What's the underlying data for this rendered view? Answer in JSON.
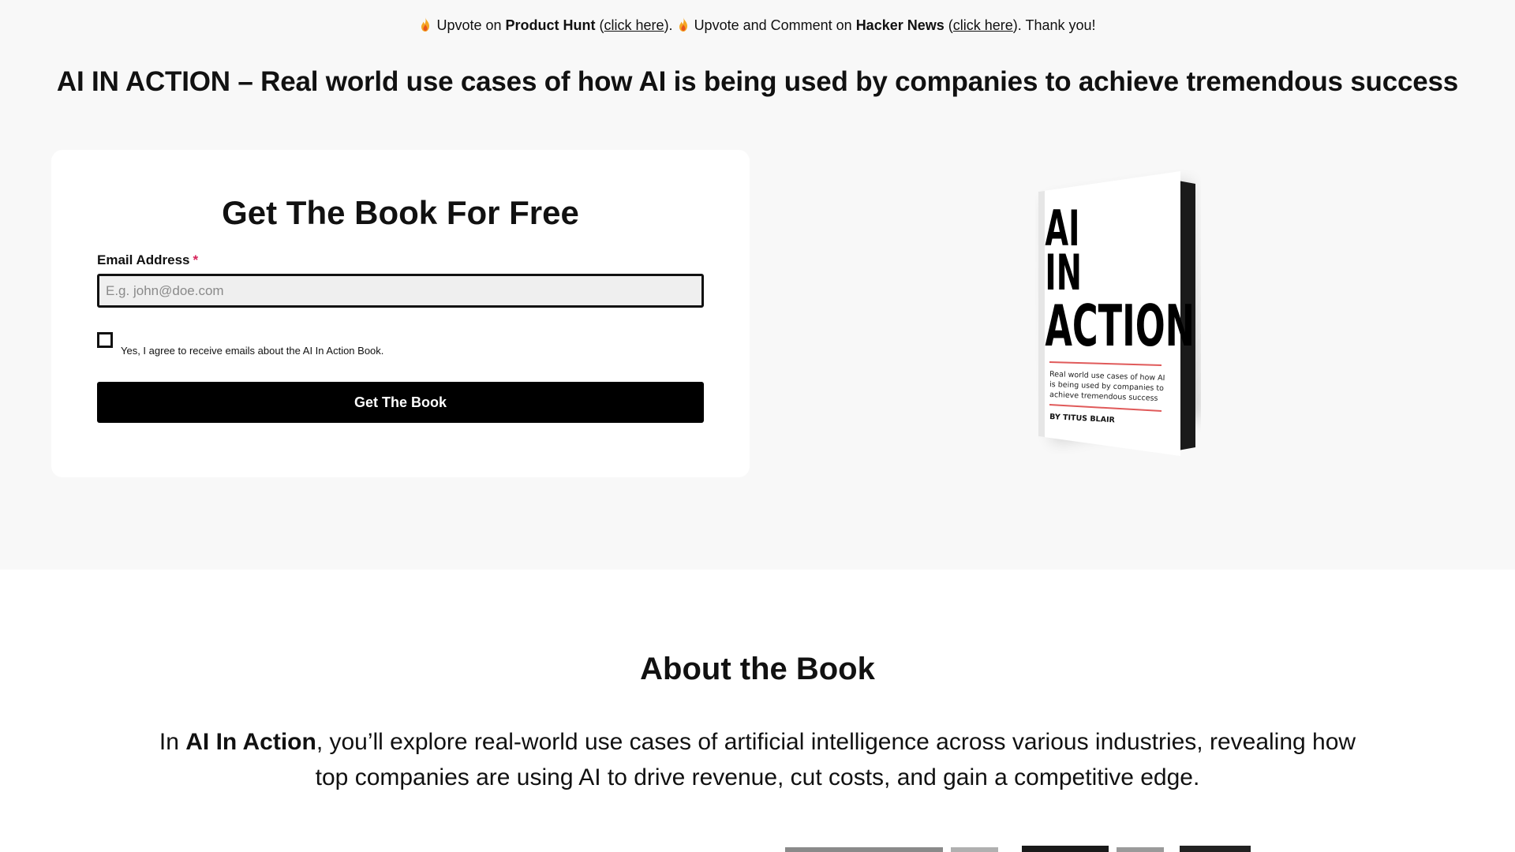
{
  "banner": {
    "part1": "Upvote on ",
    "ph_name": "Product Hunt",
    "ph_link": "click here",
    "part2": "Upvote and Comment on ",
    "hn_name": "Hacker News",
    "hn_link": "click here",
    "part3": "Thank you!"
  },
  "headline": "AI IN ACTION – Real world use cases of how AI is being used by companies to achieve tremendous success",
  "form": {
    "title": "Get The Book For Free",
    "email_label": "Email Address",
    "required_mark": "*",
    "email_placeholder": "E.g. john@doe.com",
    "consent_text": "Yes, I agree to receive emails about the AI In Action Book.",
    "submit_label": "Get The Book"
  },
  "book": {
    "title_line1": "AI",
    "title_line2": "IN",
    "title_line3": "ACTION",
    "subtitle_line1": "Real world use cases of how AI",
    "subtitle_line2": "is being used by companies to",
    "subtitle_line3": "achieve tremendous success",
    "author": "BY TITUS BLAIR"
  },
  "about": {
    "title": "About the Book",
    "intro_prefix": "In ",
    "intro_bold": "AI In Action",
    "intro_rest": ", you’ll explore real-world use cases of artificial intelligence across various industries, revealing how top companies are using AI to drive revenue, cut costs, and gain a competitive edge."
  },
  "colors": {
    "hero_bg": "#f8f8f8",
    "button_bg": "#000000",
    "required": "#d6245a",
    "book_accent": "#e05a5a"
  },
  "icons": {
    "banner": "fire-icon"
  }
}
